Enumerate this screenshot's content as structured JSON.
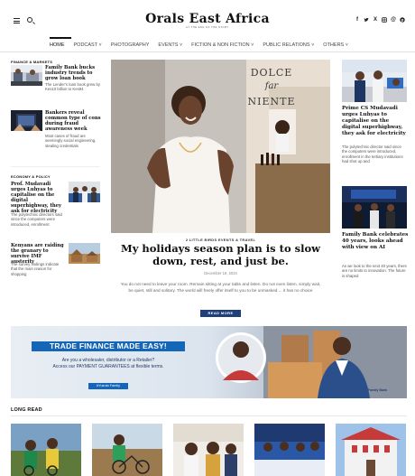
{
  "site": {
    "logo": "Orals East Africa",
    "tagline": "AT THE END OF THE STORY"
  },
  "header": {
    "menu_icon": "hamburger-icon",
    "search_icon": "search-icon",
    "social_icons": [
      "facebook-icon",
      "twitter-icon",
      "x-icon",
      "instagram-icon",
      "threads-icon",
      "pinterest-icon"
    ]
  },
  "nav": {
    "items": [
      {
        "label": "HOME"
      },
      {
        "label": "PODCAST ˅"
      },
      {
        "label": "PHOTOGRAPHY"
      },
      {
        "label": "EVENTS ˅"
      },
      {
        "label": "FICTION & NON FICTION ˅"
      },
      {
        "label": "PUBLIC RELATIONS ˅"
      },
      {
        "label": "OTHERS ˅"
      }
    ]
  },
  "left": {
    "sections": [
      {
        "label": "FINANCE & MARKETS",
        "items": [
          {
            "title": "Family Bank bucks industry trends to grow loan book",
            "desc": "The Lender's loan book grew by Kes10 billion to Kes94"
          },
          {
            "title": "Bankers reveal common type of cons during fraud awareness week",
            "desc": "Most cases of fraud are seemingly social engineering, stealing credentials"
          }
        ]
      },
      {
        "label": "ECONOMY & POLICY",
        "items": [
          {
            "title": "Prof. Mudavadi urges Luhyas to capitalise on the digital superhighway, they ask for electricity",
            "desc": "The polytechnic directors said since the computers were introduced, enrollment"
          },
          {
            "title": "Kenyans are raiding the granary to survive IMF austerity",
            "desc": "The survey findings indicate that the main reason for shopping"
          }
        ]
      }
    ]
  },
  "hero": {
    "sign_line1": "DOLCE",
    "sign_line2": "far",
    "sign_line3": "NIENTE",
    "categories": "2 LITTLE BIRDS   EVENTS & TRAVEL",
    "title": "My holidays season plan is to slow down, rest, and just be.",
    "date": "December 19, 2024",
    "excerpt": "You do not need to leave your room. Remain sitting at your table and listen. Do not even listen, simply wait, be quiet, still and solitary. The world will freely offer itself to you to be unmasked.... it has no choice",
    "button": "READ MORE"
  },
  "right": {
    "items": [
      {
        "title": "Prime CS Mudavadi urges Luhyas to capitalise on the digital superhighway, they ask for electricity",
        "desc": "The polytechnic director said since the computers were introduced, enrollment in the tertiary institutions had shot up and"
      },
      {
        "title": "Family Bank celebrates 40 years, looks ahead with view on AI",
        "desc": "As we look to the next 40 years, there are no limits to innovation. The future is shaped"
      }
    ]
  },
  "ad": {
    "headline": "TRADE FINANCE MADE EASY!",
    "line1": "Are you a wholesaler, distributor or a Retailer?",
    "line2": "Access our PAYMENT GUARANTEES at flexible terms.",
    "hashtag": "#Yuzuto Family",
    "brand": "Family Bank"
  },
  "long_read": {
    "label": "LONG READ"
  },
  "colors": {
    "accent": "#1f3f7a",
    "ad_blue": "#1466b8",
    "text": "#111111",
    "muted": "#666666"
  }
}
